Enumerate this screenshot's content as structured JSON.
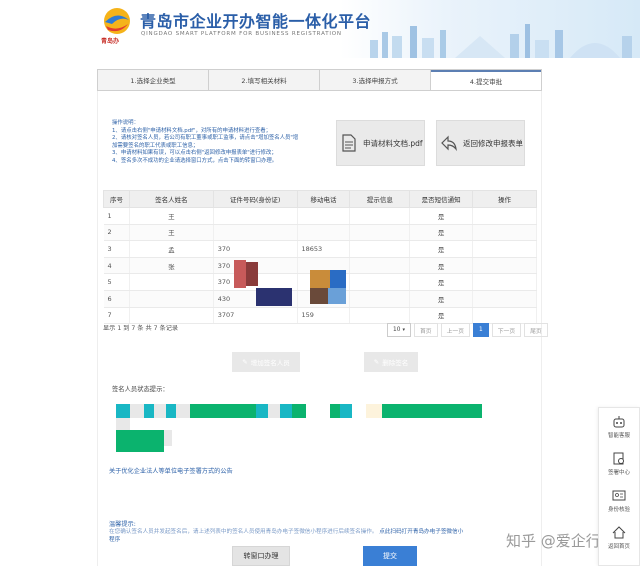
{
  "header": {
    "logo_text": "青岛办",
    "title": "青岛市企业开办智能一体化平台",
    "subtitle": "QINGDAO SMART PLATFORM FOR BUSINESS REGISTRATION"
  },
  "steps": [
    {
      "label": "1.选择企业类型",
      "active": false
    },
    {
      "label": "2.填写相关材料",
      "active": false
    },
    {
      "label": "3.选择申报方式",
      "active": false
    },
    {
      "label": "4.提交审批",
      "active": true
    }
  ],
  "instructions": {
    "title": "操作说明：",
    "lines": [
      "1、请点击右侧\"申请材料文档.pdf\"，对所有的申请材料进行查看；",
      "2、请核对签名人员，若公司有职工董事或职工监事，请点击\"增加签名人员\"增",
      "   加需要签名的职工代表或职工信息；",
      "3、申请材料如果有误，可以点击右侧\"返回修改申报表单\"进行修改；",
      "4、签名多次不成功的企业请选择窗口方式，点击下面的转窗口办理。"
    ]
  },
  "buttons": {
    "pdf": "申请材料文档.pdf",
    "back": "返回修改申报表单",
    "add_signer": "增加签名人员",
    "delete": "删除签名",
    "offline": "转窗口办理",
    "submit": "提交"
  },
  "table": {
    "headers": [
      "序号",
      "签名人姓名",
      "证件号码(身份证)",
      "移动电话",
      "提示信息",
      "是否短信通知",
      "操作"
    ],
    "rows": [
      {
        "no": "1",
        "name": "王",
        "id": "",
        "phone": "",
        "tip": "",
        "sms": "是",
        "op": ""
      },
      {
        "no": "2",
        "name": "王",
        "id": "",
        "phone": "",
        "tip": "",
        "sms": "是",
        "op": ""
      },
      {
        "no": "3",
        "name": "孟",
        "id": "370",
        "phone": "18653",
        "tip": "",
        "sms": "是",
        "op": ""
      },
      {
        "no": "4",
        "name": "张",
        "id": "370",
        "phone": "",
        "tip": "",
        "sms": "是",
        "op": ""
      },
      {
        "no": "5",
        "name": "",
        "id": "370",
        "phone": "",
        "tip": "",
        "sms": "是",
        "op": ""
      },
      {
        "no": "6",
        "name": "",
        "id": "430",
        "phone": "",
        "tip": "",
        "sms": "是",
        "op": ""
      },
      {
        "no": "7",
        "name": "",
        "id": "3707",
        "phone": "159",
        "tip": "",
        "sms": "是",
        "op": ""
      }
    ]
  },
  "pagination": {
    "info": "显示 1 到 7 条 共 7 条记录",
    "page_size": "10",
    "first": "首页",
    "prev": "上一页",
    "current": "1",
    "next": "下一页",
    "last": "尾页"
  },
  "signer_status_label": "签名人员状态提示：",
  "announcement_link": "关于优化企业法人等单位电子签署方式的公告",
  "hint": {
    "title": "温馨提示:",
    "body": "在您确认签名人员并发起签名后，请上述列表中的签名人员使用青岛办电子签微信小程序进行后续签名操作。",
    "link": "点此扫码打开青岛办电子签微信小程序"
  },
  "float_menu": [
    {
      "label": "智能客服",
      "icon": "robot-icon"
    },
    {
      "label": "签署中心",
      "icon": "sign-center-icon"
    },
    {
      "label": "身份核验",
      "icon": "id-card-icon"
    },
    {
      "label": "返回首页",
      "icon": "home-icon"
    }
  ],
  "watermark": "知乎 @爱企行"
}
